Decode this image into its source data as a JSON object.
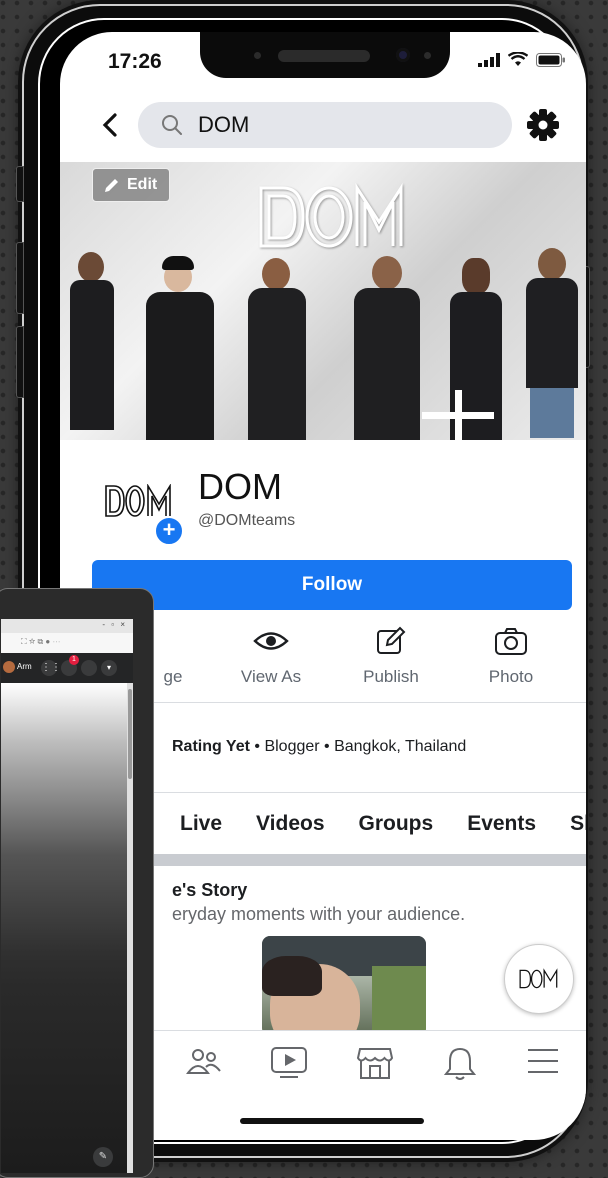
{
  "status_bar": {
    "time": "17:26"
  },
  "search": {
    "query": "DOM"
  },
  "cover": {
    "edit_label": "Edit",
    "logo_text": "DOM"
  },
  "page": {
    "name": "DOM",
    "handle": "@DOMteams",
    "profile_logo_text": "DOM"
  },
  "follow_button": {
    "label": "Follow"
  },
  "actions": [
    {
      "label": "ge",
      "icon": "flag-icon"
    },
    {
      "label": "View As",
      "icon": "eye-icon"
    },
    {
      "label": "Publish",
      "icon": "edit-icon"
    },
    {
      "label": "Photo",
      "icon": "camera-icon"
    }
  ],
  "info": {
    "rating": "Rating Yet",
    "rest": " • Blogger • Bangkok, Thailand"
  },
  "tabs": [
    "Live",
    "Videos",
    "Groups",
    "Events",
    "Sh"
  ],
  "story": {
    "title": "e's Story",
    "subtitle": "eryday moments with your audience."
  },
  "fab": {
    "logo_text": "DOM"
  },
  "bottom_nav": [
    "groups-icon",
    "watch-icon",
    "marketplace-icon",
    "notifications-icon",
    "menu-icon"
  ],
  "laptop": {
    "window_controls": "-  ▫  ×",
    "user_name": "Arm",
    "notification_count": "1"
  },
  "colors": {
    "facebook_blue": "#1877f2"
  }
}
